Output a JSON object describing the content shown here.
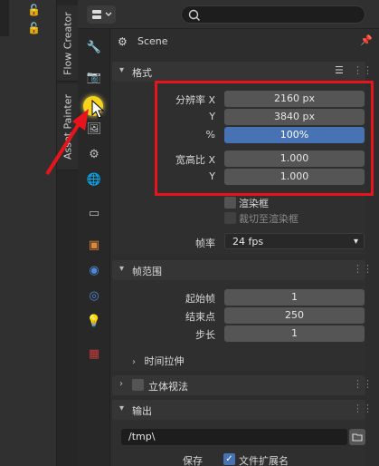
{
  "sidebar_tabs": [
    "Flow Creator",
    "Asset Painter"
  ],
  "header": {
    "search_placeholder": ""
  },
  "scene": {
    "title": "Scene"
  },
  "format": {
    "title": "格式",
    "resolution_x_label": "分辨率 X",
    "resolution_y_label": "Y",
    "percent_label": "%",
    "resolution_x": "2160 px",
    "resolution_y": "3840 px",
    "percent": "100%",
    "aspect_x_label": "宽高比 X",
    "aspect_y_label": "Y",
    "aspect_x": "1.000",
    "aspect_y": "1.000",
    "render_region_label": "渲染框",
    "crop_label": "裁切至渲染框",
    "frame_rate_label": "帧率",
    "frame_rate": "24 fps"
  },
  "frame_range": {
    "title": "帧范围",
    "start_label": "起始帧",
    "start": "1",
    "end_label": "结束点",
    "end": "250",
    "step_label": "步长",
    "step": "1",
    "time_stretch_label": "时间拉伸"
  },
  "stereoscopy": {
    "title": "立体视法"
  },
  "output": {
    "title": "输出",
    "path": "/tmp\\",
    "save_label": "保存",
    "file_extension_label": "文件扩展名"
  },
  "colors": {
    "highlight_box": "#e8141c",
    "accent": "#4772b3"
  }
}
